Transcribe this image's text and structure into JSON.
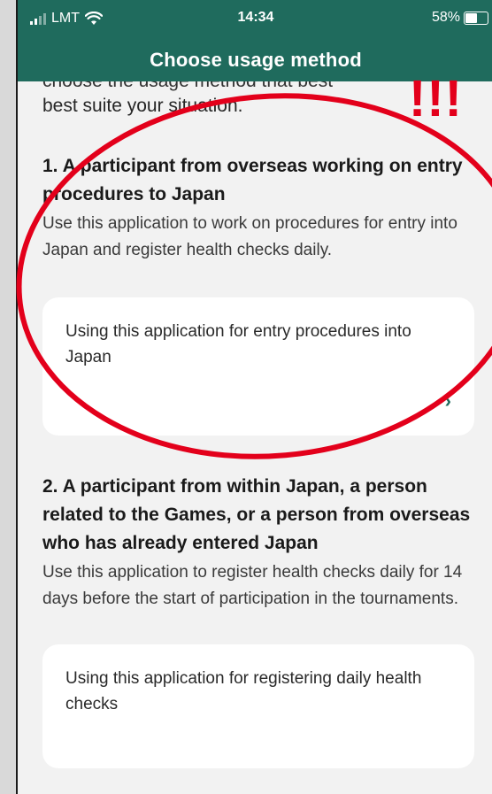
{
  "status_bar": {
    "carrier": "LMT",
    "time": "14:34",
    "battery": "58%",
    "battery_level": 0.58
  },
  "header": {
    "title": "Choose usage method"
  },
  "intro": {
    "clipped_text": "choose the usage method that best",
    "text": "best suite your situation."
  },
  "sections": [
    {
      "title": "1. A participant from overseas working on entry procedures to Japan",
      "description": "Use this application to work on procedures for entry into Japan and register health checks daily.",
      "option_label": "Using this application for entry procedures into Japan"
    },
    {
      "title": "2. A participant from within Japan, a person related to the Games, or a person from overseas who has already entered Japan",
      "description": "Use this application to register health checks daily for 14 days before the start of participation in the tournaments.",
      "option_label": "Using this application for registering daily health checks"
    }
  ],
  "annotation": {
    "marker_text": "!!!",
    "color": "#e3001b"
  },
  "colors": {
    "header_bg": "#1f6b5d",
    "page_bg": "#f2f2f2",
    "card_bg": "#ffffff",
    "accent": "#1f6b5d"
  },
  "icons": {
    "signal": "signal-bars-icon",
    "wifi": "wifi-icon",
    "battery": "battery-icon",
    "chevron": "chevron-right-icon"
  }
}
